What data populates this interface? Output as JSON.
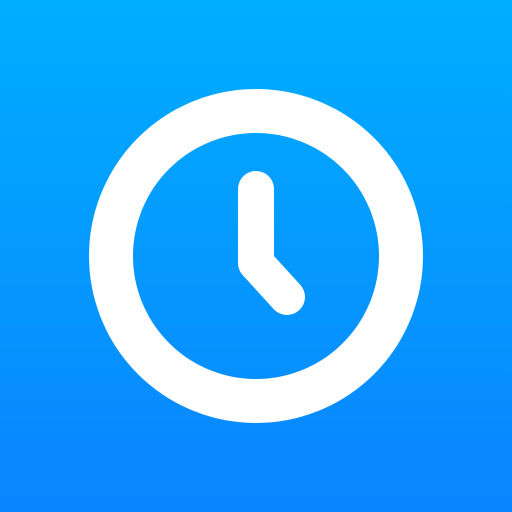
{
  "icon": {
    "name": "clock-icon",
    "gradient_top": "#00AEFF",
    "gradient_bottom": "#0A84FF",
    "glyph_color": "#FFFFFF"
  }
}
